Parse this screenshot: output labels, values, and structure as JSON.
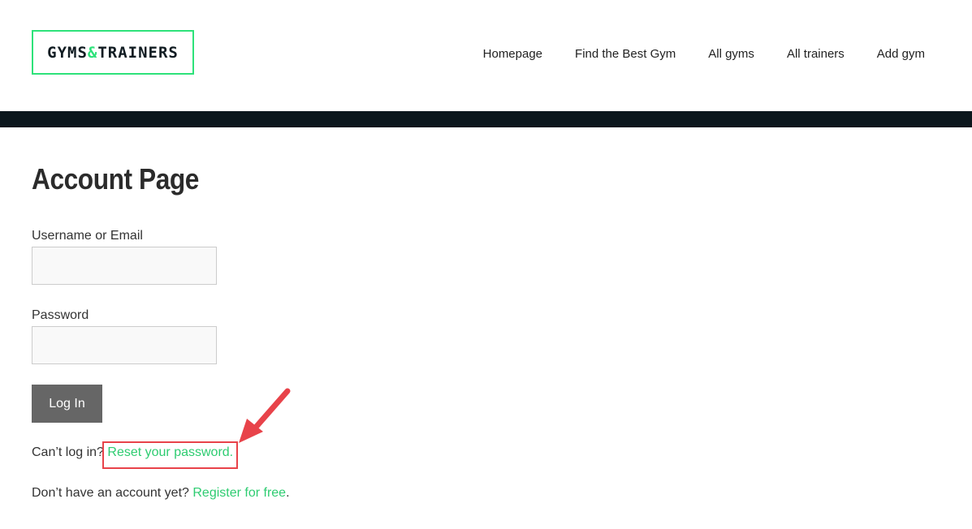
{
  "header": {
    "logo": {
      "part1": "GYMS",
      "amp": "&",
      "part2": "TRAINERS"
    },
    "nav": [
      "Homepage",
      "Find the Best Gym",
      "All gyms",
      "All trainers",
      "Add gym"
    ]
  },
  "main": {
    "title": "Account Page",
    "username": {
      "label": "Username or Email",
      "value": "",
      "placeholder": ""
    },
    "password": {
      "label": "Password",
      "value": "",
      "placeholder": ""
    },
    "login_label": "Log In",
    "reset": {
      "prefix": "Can’t log in? ",
      "link": "Reset your password."
    },
    "register": {
      "prefix": "Don’t have an account yet? ",
      "link": "Register for free",
      "suffix": "."
    }
  },
  "colors": {
    "accent": "#2ee27a",
    "link": "#2ecc71",
    "band": "#0c171d",
    "button": "#666666",
    "annotation": "#e8434a"
  },
  "annotation": {
    "highlight_icon": "arrow-pointer-icon"
  }
}
